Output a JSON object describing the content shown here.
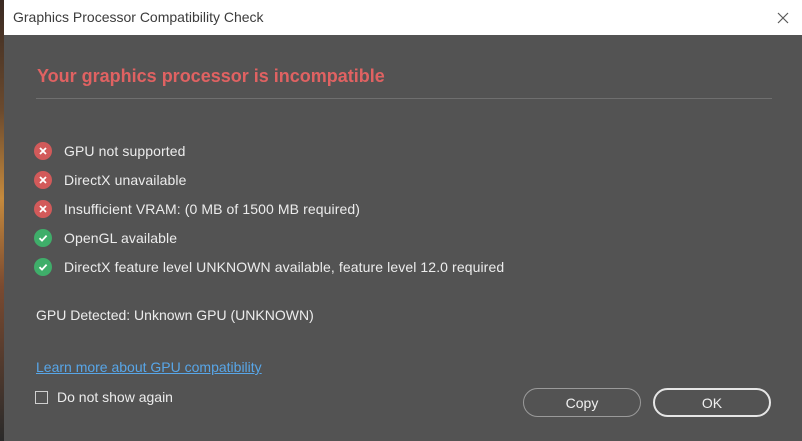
{
  "window": {
    "title": "Graphics Processor Compatibility Check"
  },
  "heading": "Your graphics processor is incompatible",
  "checks": [
    {
      "status": "fail",
      "label": "GPU not supported"
    },
    {
      "status": "fail",
      "label": "DirectX unavailable"
    },
    {
      "status": "fail",
      "label": "Insufficient VRAM: (0 MB of 1500 MB required)"
    },
    {
      "status": "pass",
      "label": "OpenGL available"
    },
    {
      "status": "pass",
      "label": "DirectX feature level UNKNOWN available, feature level 12.0 required"
    }
  ],
  "gpu_detected": "GPU Detected: Unknown GPU (UNKNOWN)",
  "learn_more_link": "Learn more about GPU compatibility",
  "dont_show_again": {
    "label": "Do not show again",
    "checked": false
  },
  "buttons": {
    "copy": "Copy",
    "ok": "OK"
  },
  "colors": {
    "dialog_bg": "#535353",
    "heading": "#e06262",
    "fail": "#d25a5a",
    "pass": "#3fae6a",
    "link": "#58a6e8"
  },
  "icons": {
    "fail": "x-circle-icon",
    "pass": "check-circle-icon",
    "close": "close-icon"
  }
}
